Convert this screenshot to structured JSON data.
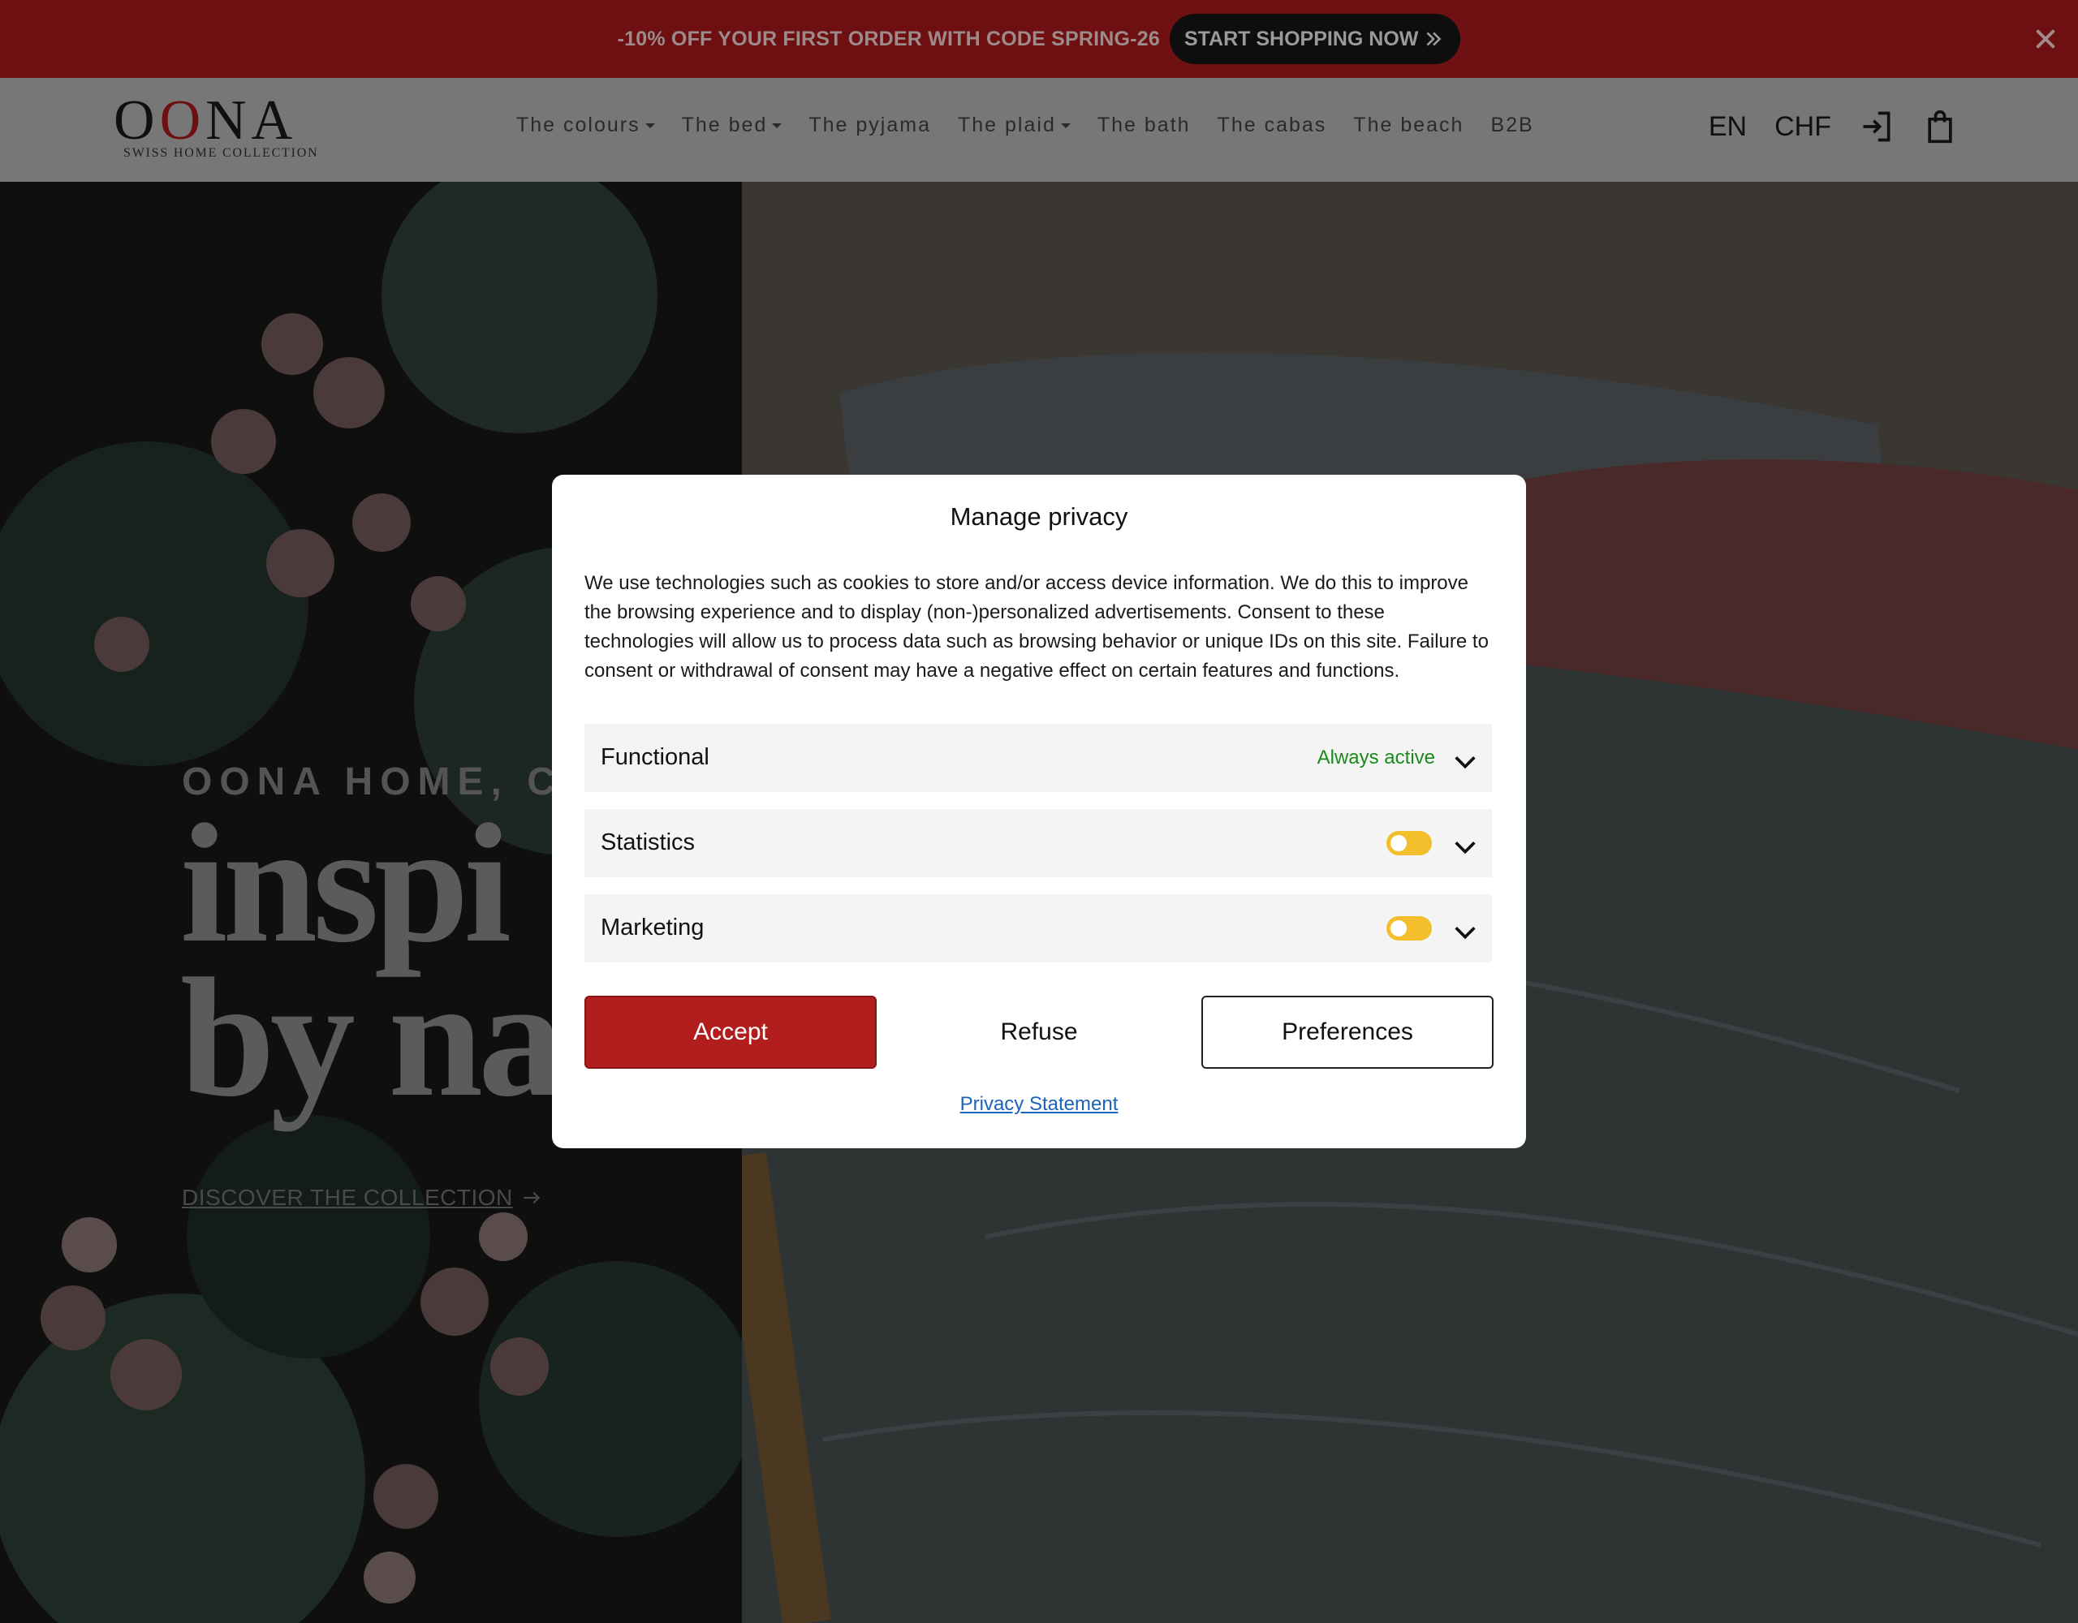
{
  "promo": {
    "text": "-10% OFF YOUR FIRST ORDER WITH CODE SPRING-26",
    "cta_label": "START SHOPPING NOW",
    "close_icon": "close-icon"
  },
  "header": {
    "logo": {
      "word_start": "O",
      "word_red": "O",
      "word_end": "NA",
      "tagline": "SWISS HOME COLLECTION"
    },
    "nav": [
      {
        "label": "The colours",
        "has_dropdown": true
      },
      {
        "label": "The bed",
        "has_dropdown": true
      },
      {
        "label": "The pyjama",
        "has_dropdown": false
      },
      {
        "label": "The plaid",
        "has_dropdown": true
      },
      {
        "label": "The bath",
        "has_dropdown": false
      },
      {
        "label": "The cabas",
        "has_dropdown": false
      },
      {
        "label": "The beach",
        "has_dropdown": false
      },
      {
        "label": "B2B",
        "has_dropdown": false
      }
    ],
    "language": "EN",
    "currency": "CHF",
    "login_icon": "login-icon",
    "cart_icon": "shopping-bag-icon"
  },
  "hero": {
    "eyebrow": "OONA HOME, CO",
    "title_line1": "inspi",
    "title_line2": "by na",
    "link_label": "DISCOVER THE COLLECTION"
  },
  "privacy_dialog": {
    "title": "Manage privacy",
    "body": "We use technologies such as cookies to store and/or access device information. We do this to improve the browsing experience and to display (non-)personalized advertisements. Consent to these technologies will allow us to process data such as browsing behavior or unique IDs on this site. Failure to consent or withdrawal of consent may have a negative effect on certain features and functions.",
    "categories": [
      {
        "label": "Functional",
        "status": "Always active"
      },
      {
        "label": "Statistics",
        "toggle": "off"
      },
      {
        "label": "Marketing",
        "toggle": "off"
      }
    ],
    "accept_label": "Accept",
    "refuse_label": "Refuse",
    "preferences_label": "Preferences",
    "privacy_link": "Privacy Statement"
  },
  "colors": {
    "brand_red": "#6e1012",
    "accept_red": "#b21d1d",
    "active_green": "#1a8a1a",
    "toggle_yellow": "#f2be2c",
    "link_blue": "#1a63b8"
  }
}
